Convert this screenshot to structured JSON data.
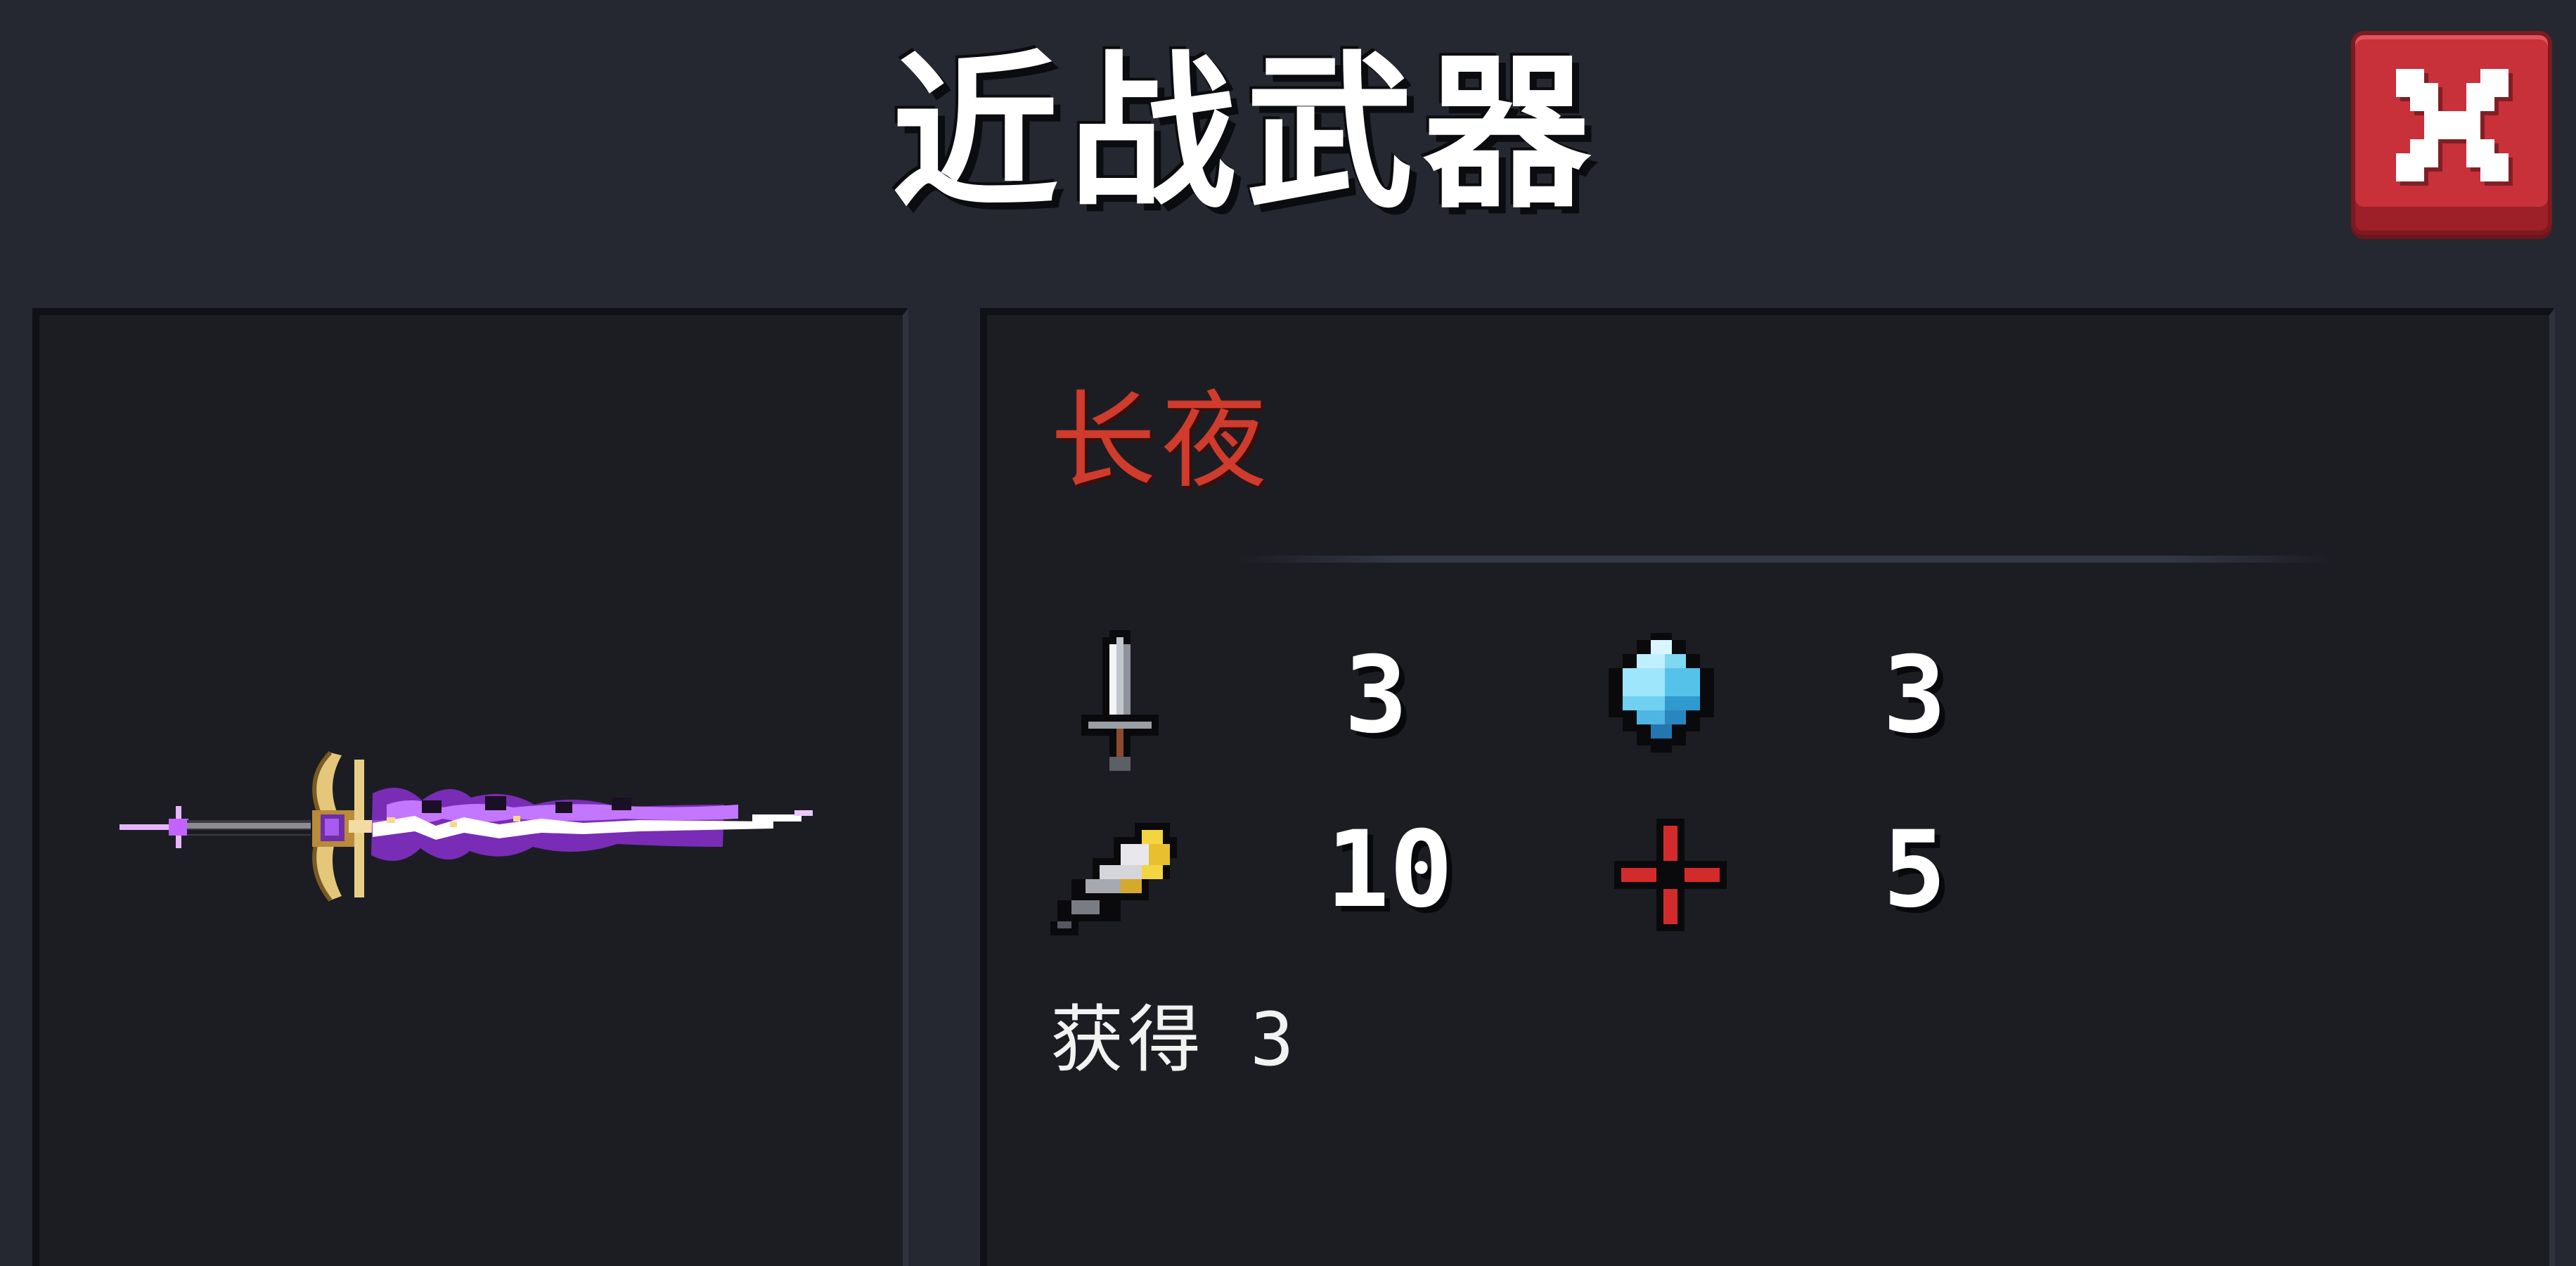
{
  "header": {
    "title": "近战武器",
    "close_icon": "close-x-icon"
  },
  "weapon": {
    "name": "长夜",
    "name_color": "#cf3b2c",
    "image_icon": "purple-lightning-sword-icon"
  },
  "stats": [
    {
      "icon": "damage-sword-icon",
      "value": "3"
    },
    {
      "icon": "energy-crystal-icon",
      "value": "3"
    },
    {
      "icon": "critical-feather-icon",
      "value": "10"
    },
    {
      "icon": "accuracy-crosshair-icon",
      "value": "5"
    }
  ],
  "obtain": {
    "label": "获得",
    "value": "3"
  },
  "colors": {
    "background": "#252830",
    "panel": "#1c1d23",
    "close_button": "#c8303a",
    "weapon_glow": "#a13bd8"
  }
}
